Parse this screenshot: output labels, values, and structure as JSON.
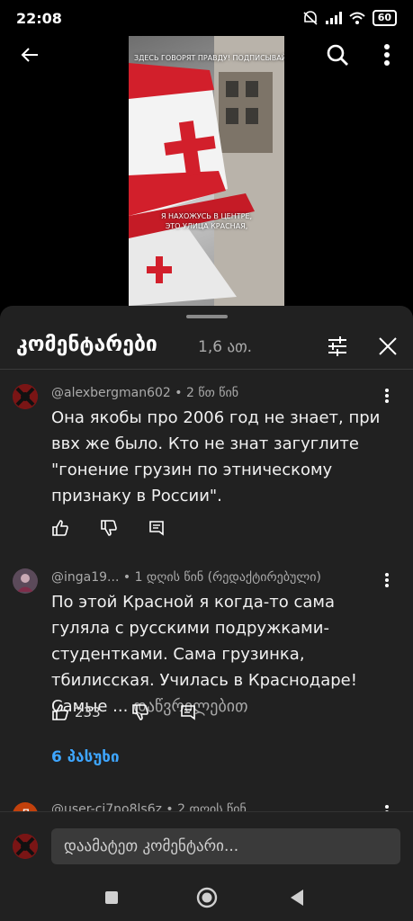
{
  "status": {
    "time": "22:08",
    "battery": "60"
  },
  "video": {
    "overlay_top": "ЗДЕСЬ ГОВОРЯТ ПРАВДУ! ПОДПИСЫВАЙ",
    "caption_line1": "Я НАХОЖУСЬ В ЦЕНТРЕ,",
    "caption_line2": "ЭТО УЛИЦА КРАСНАЯ,"
  },
  "sheet": {
    "title": "კომენტარები",
    "count": "1,6 ათ."
  },
  "comments": [
    {
      "author": "@alexbergman602",
      "time": "2 წთ წინ",
      "text": "Она якобы про 2006 год не знает, при ввх же было. Кто не знат загуглите \"гонение грузин по этническому признаку в России\".",
      "likes": ""
    },
    {
      "author": "@inga19...",
      "time": "1 დღის წინ (რედაქტირებული)",
      "text": "По этой Красной я когда-то сама гуляла с русскими подружками- студентками. Сама грузинка, тбилисская.  Училась в Краснодаре! Самые ...",
      "more": "დაწვრილებით",
      "likes": "233",
      "replies": "6 პასუხი"
    },
    {
      "author": "@user-ci7no8ls6z",
      "time": "2 დღის წინ",
      "avatar_letter": "Л"
    }
  ],
  "input": {
    "placeholder": "დაამატეთ კომენტარი..."
  },
  "colors": {
    "sheet_bg": "#212121",
    "link": "#3ea6ff",
    "flag_red": "#d21f2b"
  }
}
